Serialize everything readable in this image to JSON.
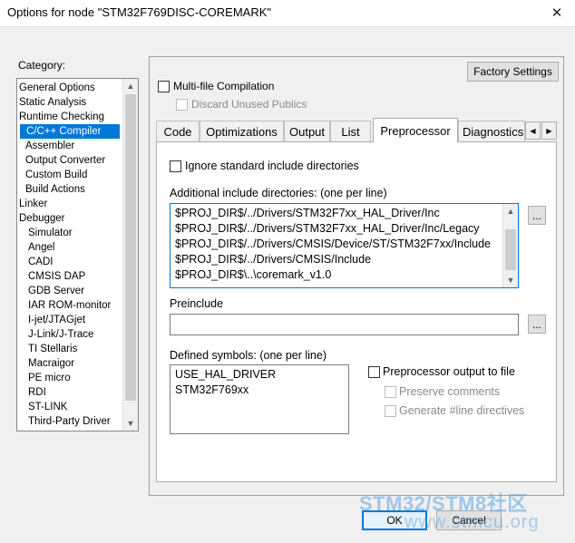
{
  "window": {
    "title": "Options for node \"STM32F769DISC-COREMARK\"",
    "close_glyph": "✕"
  },
  "category": {
    "label": "Category:",
    "items": [
      "General Options",
      "Static Analysis",
      "Runtime Checking",
      "C/C++ Compiler",
      "Assembler",
      "Output Converter",
      "Custom Build",
      "Build Actions",
      "Linker",
      "Debugger",
      "Simulator",
      "Angel",
      "CADI",
      "CMSIS DAP",
      "GDB Server",
      "IAR ROM-monitor",
      "I-jet/JTAGjet",
      "J-Link/J-Trace",
      "TI Stellaris",
      "Macraigor",
      "PE micro",
      "RDI",
      "ST-LINK",
      "Third-Party Driver"
    ],
    "selected": "C/C++ Compiler"
  },
  "top": {
    "factory_settings": "Factory Settings",
    "multi_file": "Multi-file Compilation",
    "discard_unused": "Discard Unused Publics"
  },
  "tabs": [
    "Code",
    "Optimizations",
    "Output",
    "List",
    "Preprocessor",
    "Diagnostics"
  ],
  "active_tab": "Preprocessor",
  "preprocessor": {
    "ignore_std": "Ignore standard include directories",
    "include_label": "Additional include directories: (one per line)",
    "include_lines": [
      "$PROJ_DIR$/../Drivers/STM32F7xx_HAL_Driver/Inc",
      "$PROJ_DIR$/../Drivers/STM32F7xx_HAL_Driver/Inc/Legacy",
      "$PROJ_DIR$/../Drivers/CMSIS/Device/ST/STM32F7xx/Include",
      "$PROJ_DIR$/../Drivers/CMSIS/Include",
      "$PROJ_DIR$\\..\\coremark_v1.0"
    ],
    "preinclude_label": "Preinclude",
    "preinclude_value": "",
    "browse": "...",
    "defined_label": "Defined symbols: (one per line)",
    "defined_lines": [
      "USE_HAL_DRIVER",
      "STM32F769xx"
    ],
    "pp_output": "Preprocessor output to file",
    "preserve_comments": "Preserve comments",
    "generate_line": "Generate #line directives"
  },
  "buttons": {
    "ok": "OK",
    "cancel": "Cancel"
  },
  "watermark": {
    "line1": "STM32/STM8社区",
    "line2": "www.stmcu.org"
  },
  "colors": {
    "selection": "#0078d7",
    "focus_border": "#0078d7"
  }
}
